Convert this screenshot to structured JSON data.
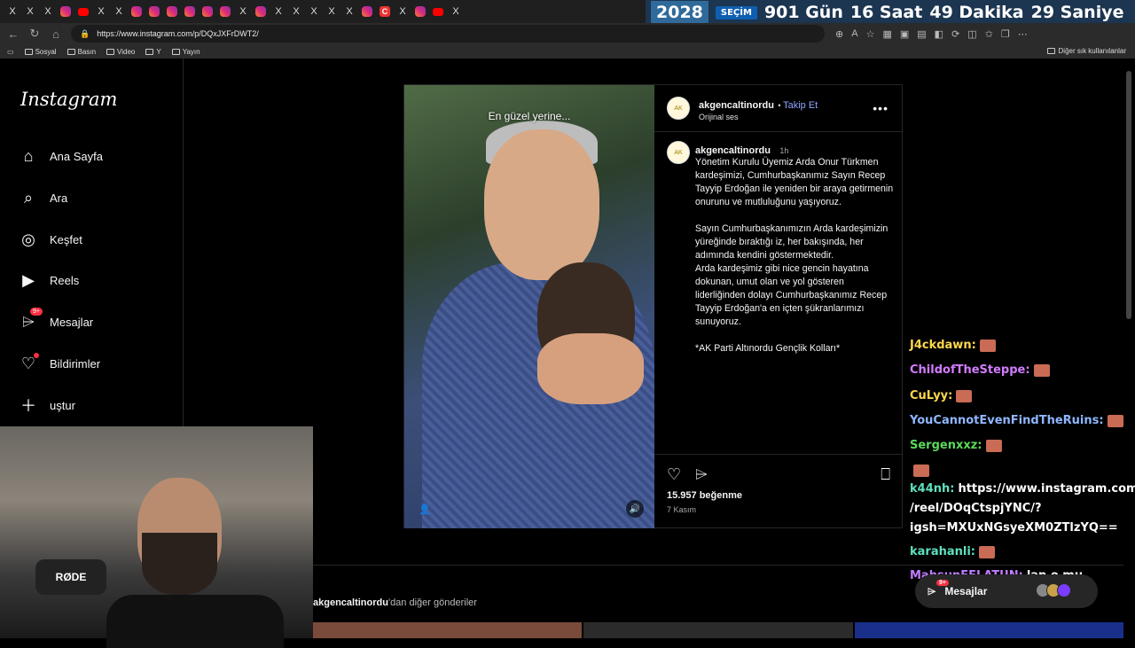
{
  "browser": {
    "url": "https://www.instagram.com/p/DQxJXFrDWT2/",
    "bookmarks": [
      "Sosyal",
      "Basın",
      "Video",
      "Y",
      "Yayın"
    ],
    "bookmarks_right": "Diğer sık kullanılanlar",
    "tab_icons": [
      "x",
      "x",
      "x",
      "ig",
      "yt",
      "x",
      "x",
      "ig",
      "ig",
      "ig",
      "ig",
      "ig",
      "ig",
      "x",
      "ig",
      "x",
      "x",
      "x",
      "x",
      "x",
      "ig",
      "c",
      "x",
      "ig",
      "yt",
      "x"
    ]
  },
  "countdown": {
    "year": "2028",
    "label": "SEÇİM",
    "days": "901 Gün",
    "hours": "16 Saat",
    "minutes": "49 Dakika",
    "seconds": "29 Saniye"
  },
  "sidebar": {
    "logo": "Instagram",
    "items": [
      {
        "label": "Ana Sayfa",
        "icon": "home-icon"
      },
      {
        "label": "Ara",
        "icon": "search-icon"
      },
      {
        "label": "Keşfet",
        "icon": "compass-icon"
      },
      {
        "label": "Reels",
        "icon": "reels-icon"
      },
      {
        "label": "Mesajlar",
        "icon": "messenger-icon",
        "badge": "9+"
      },
      {
        "label": "Bildirimler",
        "icon": "heart-icon"
      },
      {
        "label": "uştur",
        "icon": "create-icon"
      }
    ]
  },
  "post": {
    "overlay_caption": "En güzel yerine...",
    "username": "akgencaltinordu",
    "follow": "Takip Et",
    "audio": "Orijinal ses",
    "time": "1h",
    "caption": [
      "Yönetim Kurulu Üyemiz Arda Onur Türkmen kardeşimizi, Cumhurbaşkanımız Sayın Recep Tayyip Erdoğan ile yeniden bir araya getirmenin onurunu ve mutluluğunu yaşıyoruz.",
      "Sayın Cumhurbaşkanımızın Arda kardeşimizin yüreğinde bıraktığı iz, her bakışında, her adımında kendini göstermektedir.",
      "Arda kardeşimiz gibi nice gencin hayatına dokunan, umut olan ve yol gösteren liderliğinden dolayı  Cumhurbaşkanımız Recep Tayyip Erdoğan'a en içten şükranlarımızı sunuyoruz.",
      "*AK Parti Altınordu Gençlik Kolları*"
    ],
    "likes": "15.957 beğenme",
    "date": "7 Kasım"
  },
  "more_posts": {
    "user": "akgencaltinordu",
    "suffix": "'dan diğer gönderiler"
  },
  "chat": [
    {
      "user": "J4ckdawn:",
      "text": "",
      "color": "#ffd84a"
    },
    {
      "user": "ChildofTheSteppe:",
      "text": "",
      "color": "#d27cff"
    },
    {
      "user": "CuLyy:",
      "text": "",
      "color": "#ffd84a"
    },
    {
      "user": "YouCannotEvenFindTheRuins:",
      "text": "",
      "color": "#8fb6ff"
    },
    {
      "user": "Sergenxxz:",
      "text": "",
      "color": "#5bd95b"
    },
    {
      "user": "",
      "text": "",
      "color": "#ffffff"
    },
    {
      "user": "k44nh:",
      "text": "https://www.instagram.com",
      "color": "#5fe0c0"
    },
    {
      "user": "",
      "text": "/reel/DOqCtspjYNC/?",
      "color": "#ffffff"
    },
    {
      "user": "",
      "text": "igsh=MXUxNGsyeXM0ZTlzYQ==",
      "color": "#ffffff"
    },
    {
      "user": "karahanli:",
      "text": "",
      "color": "#5fe0c0"
    },
    {
      "user": "MahsunEFLATUN:",
      "text": "lan o mu",
      "color": "#c07cff"
    }
  ],
  "messages_bar": {
    "label": "Mesajlar",
    "badge": "9+"
  }
}
